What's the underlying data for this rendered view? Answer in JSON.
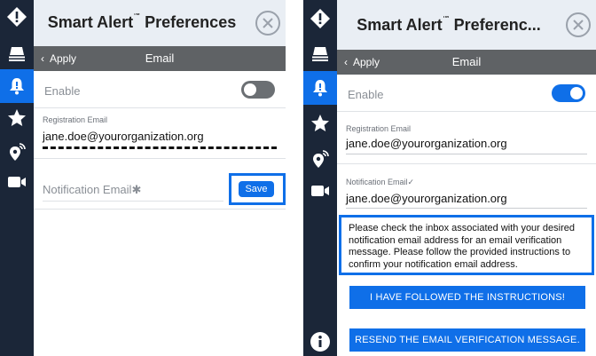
{
  "left": {
    "header": {
      "title": "Smart Alert",
      "trademark": "™",
      "title_rest": " Preferences"
    },
    "subbar": {
      "back_label": "Apply",
      "title": "Email"
    },
    "enable": {
      "label": "Enable",
      "on": false
    },
    "registration": {
      "label": "Registration Email",
      "value": "jane.doe@yourorganization.org"
    },
    "notification": {
      "placeholder": "Notification Email",
      "asterisk": "✱",
      "save_label": "Save"
    }
  },
  "right": {
    "header": {
      "title": "Smart Alert",
      "trademark": "™",
      "title_rest": " Preferenc..."
    },
    "subbar": {
      "back_label": "Apply",
      "title": "Email"
    },
    "enable": {
      "label": "Enable",
      "on": true
    },
    "registration": {
      "label": "Registration Email",
      "value": "jane.doe@yourorganization.org"
    },
    "notification": {
      "label": "Notification Email",
      "check": "✓",
      "value": "jane.doe@yourorganization.org"
    },
    "message": "Please check the inbox associated with your desired notification email address for an email verification message. Please follow the provided instructions to confirm your notification email address.",
    "buttons": {
      "followed": "I HAVE FOLLOWED THE INSTRUCTIONS!",
      "resend": "RESEND THE EMAIL VERIFICATION MESSAGE."
    }
  },
  "rail_icons": [
    "alert-diamond-icon",
    "stack-icon",
    "bell-icon",
    "star-icon",
    "location-signal-icon",
    "video-camera-icon",
    "info-icon"
  ],
  "colors": {
    "accent": "#0f6fe8",
    "rail": "#1b2638",
    "subbar": "#5f6265",
    "header": "#e9eef4",
    "toggle_off": "#6b6f73"
  }
}
